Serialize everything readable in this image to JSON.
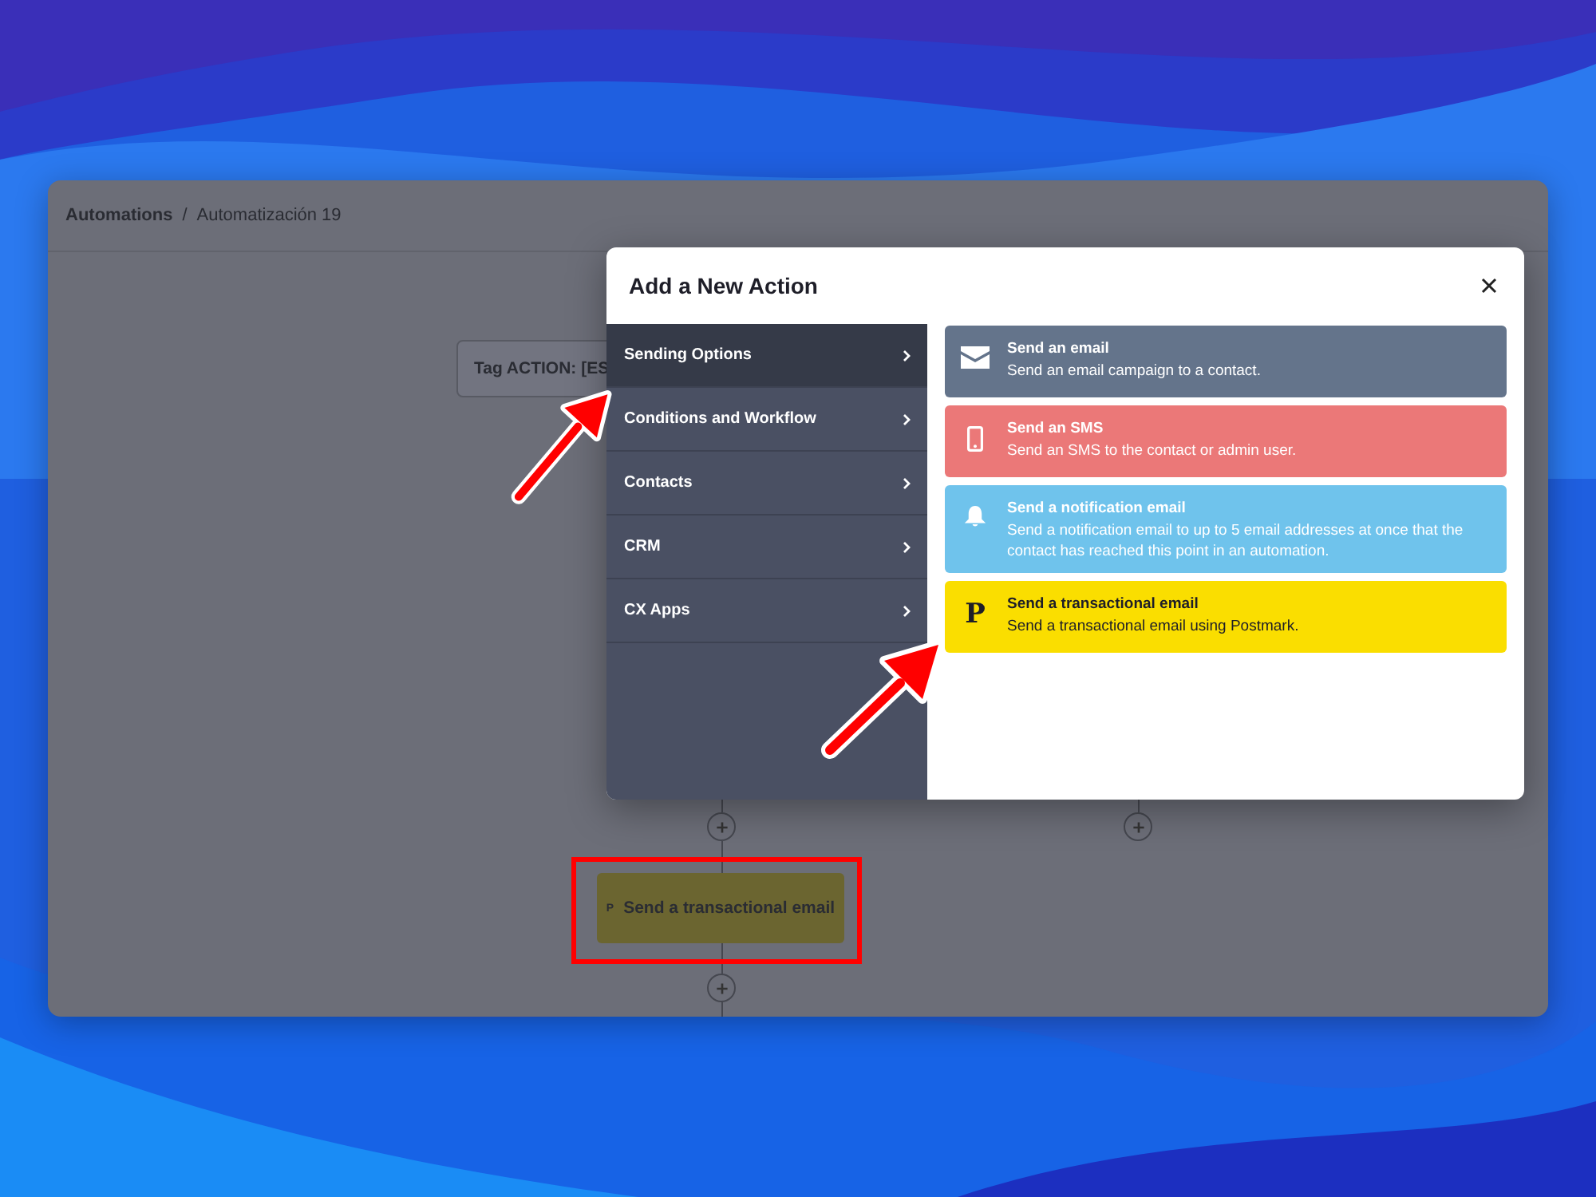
{
  "breadcrumb": {
    "root": "Automations",
    "separator": "/",
    "current": "Automatización 19"
  },
  "canvas": {
    "nodes": [
      {
        "kind": "tag",
        "label": "Tag ACTION: [ES"
      },
      {
        "kind": "transactional",
        "icon_text": "P",
        "label": "Send a transactional email",
        "highlighted": true
      }
    ]
  },
  "modal": {
    "title": "Add a New Action",
    "categories": [
      {
        "label": "Sending Options",
        "selected": true
      },
      {
        "label": "Conditions and Workflow",
        "selected": false
      },
      {
        "label": "Contacts",
        "selected": false
      },
      {
        "label": "CRM",
        "selected": false
      },
      {
        "label": "CX Apps",
        "selected": false
      }
    ],
    "actions": [
      {
        "kind": "envelope",
        "color": "#64748b",
        "title": "Send an email",
        "description": "Send an email campaign to a contact."
      },
      {
        "kind": "phone",
        "color": "#eb7878",
        "title": "Send an SMS",
        "description": "Send an SMS to the contact or admin user."
      },
      {
        "kind": "bell",
        "color": "#6fc3ec",
        "title": "Send a notification email",
        "description": "Send a notification email to up to 5 email addresses at once that the contact has reached this point in an automation."
      },
      {
        "kind": "letter",
        "icon_text": "P",
        "color": "#fade00",
        "title": "Send a transactional email",
        "description": "Send a transactional email using Postmark."
      }
    ]
  }
}
